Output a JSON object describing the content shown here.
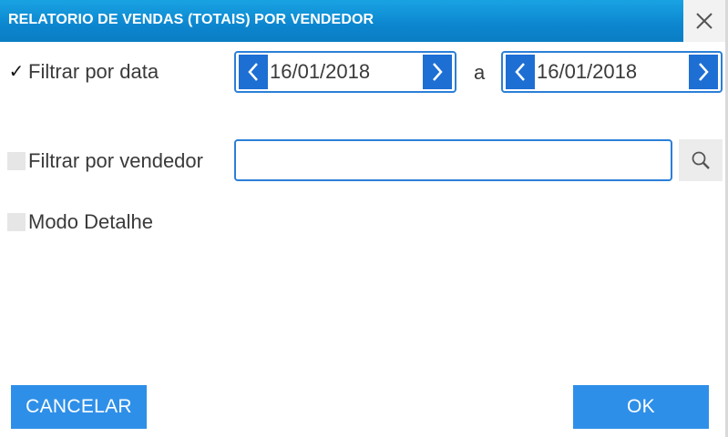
{
  "window": {
    "title": "RELATORIO DE VENDAS (TOTAIS) POR VENDEDOR",
    "close_icon": "close-icon"
  },
  "filters": {
    "date": {
      "label": "Filtrar por data",
      "checked": true,
      "from": "16/01/2018",
      "separator": "a",
      "to": "16/01/2018"
    },
    "seller": {
      "label": "Filtrar por vendedor",
      "checked": false,
      "value": "",
      "search_icon": "search-icon"
    },
    "detail": {
      "label": "Modo Detalhe",
      "checked": false
    }
  },
  "buttons": {
    "cancel": "CANCELAR",
    "ok": "OK"
  },
  "colors": {
    "title_bar": "#0c86cf",
    "accent": "#1d6fd4",
    "button": "#2e8fe8"
  }
}
